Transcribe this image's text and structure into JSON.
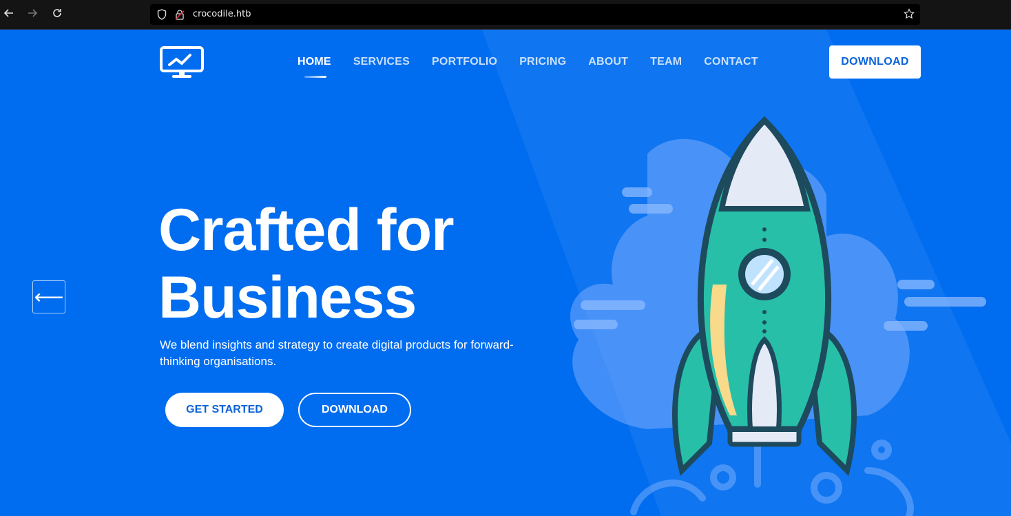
{
  "browser": {
    "url": "crocodile.htb",
    "back_icon": "arrow-left-icon",
    "forward_icon": "arrow-right-icon",
    "reload_icon": "reload-icon",
    "shield_icon": "shield-icon",
    "lock_icon": "insecure-lock-icon",
    "bookmark_icon": "star-icon"
  },
  "header": {
    "logo_icon": "monitor-chart-icon",
    "nav": [
      {
        "label": "HOME",
        "active": true
      },
      {
        "label": "SERVICES"
      },
      {
        "label": "PORTFOLIO"
      },
      {
        "label": "PRICING"
      },
      {
        "label": "ABOUT"
      },
      {
        "label": "TEAM"
      },
      {
        "label": "CONTACT"
      }
    ],
    "download_label": "DOWNLOAD"
  },
  "hero": {
    "title_line1": "Crafted for",
    "title_line2": "Business",
    "subtitle": "We blend insights and strategy to create digital products for forward-thinking organisations.",
    "cta_primary": "GET STARTED",
    "cta_secondary": "DOWNLOAD",
    "prev_arrow": "⟵"
  },
  "colors": {
    "background": "#006df0",
    "accent_button_text": "#0a62d9",
    "rocket_body": "#27bfa8",
    "rocket_outline": "#1d4a5c"
  }
}
